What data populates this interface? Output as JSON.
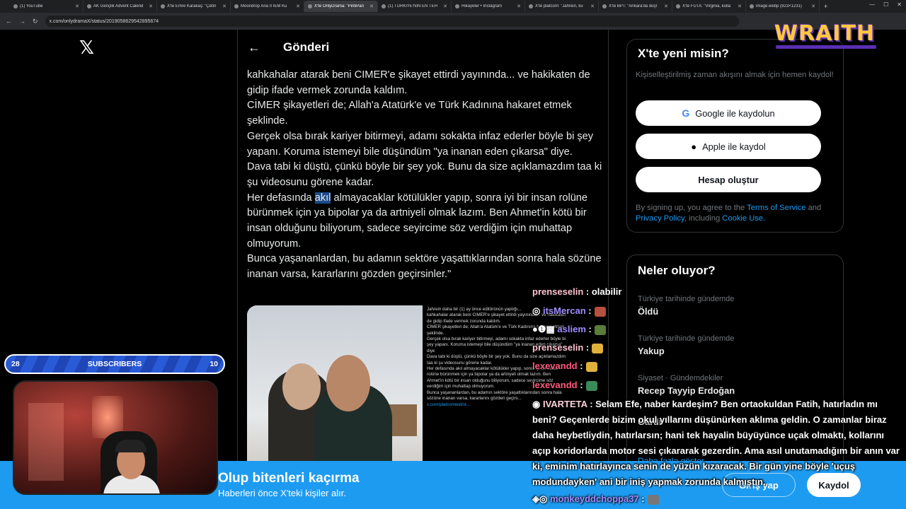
{
  "browser": {
    "tabs": [
      {
        "label": "(1) YouTube",
        "active": false
      },
      {
        "label": "AK Gençlik Advent Calend",
        "active": false
      },
      {
        "label": "X'te Emre Karakaş: \"Çetin",
        "active": false
      },
      {
        "label": "Moondrop Aria II IEM Ku",
        "active": false
      },
      {
        "label": "X'te OnlyDrama: \"PintiPan",
        "active": true
      },
      {
        "label": "(1) TÜRKİYE'NİN EN TEH",
        "active": false
      },
      {
        "label": "Hikayeler • Instagram",
        "active": false
      },
      {
        "label": "X'te platcom: \"Jahrein, ku",
        "active": false
      },
      {
        "label": "X'te BPT: \"Ankara'da düşt",
        "active": false
      },
      {
        "label": "X'te FUTA: \"Virginia, kulla",
        "active": false
      },
      {
        "label": "image.webp (923×1231)",
        "active": false
      }
    ],
    "url": "x.com/onlydramaX/status/2019058629542895674"
  },
  "post": {
    "header_title": "Gönderi",
    "lines": [
      "kahkahalar atarak beni CIMER'e şikayet ettirdi yayınında... ve hakikaten de gidip ifade vermek zorunda kaldım.",
      "CİMER şikayetleri de; Allah'a Atatürk'e ve Türk Kadınına hakaret etmek şeklinde.",
      "Gerçek olsa bırak kariyer bitirmeyi, adamı sokakta infaz ederler böyle bi şey yapanı. Koruma istemeyi bile düşündüm \"ya inanan eden çıkarsa\" diye.",
      "Dava tabi ki düştü, çünkü böyle bir şey yok. Bunu da size açıklamazdım taa ki şu videosunu görene kadar."
    ],
    "line5_before": "Her defasında ",
    "line5_highlight": "akıl",
    "line5_after": " almayacaklar kötülükler yapıp, sonra iyi bir insan rolüne bürünmek için ya bipolar ya da artniyeli olmak lazım. Ben Ahmet'in kötü bir insan olduğunu biliyorum, sadece seyircime söz verdiğim için muhattap olmuyorum.",
    "line6": "Bunca yaşananlardan, bu adamın sektöre yaşattıklarından sonra hala sözüne inanan varsa, kararlarını gözden geçirsinler.\"",
    "media_text": [
      "Jahrein daha bir (1) ay önce editörünün yaptığı...",
      "kahkahalar atarak beni CIMER'e şikayet ettirdi yayınında... ve hakikaten",
      "de gidip ifade vermek zorunda kaldım.",
      "CİMER şikayetleri de; Allah'a Atatürk'e ve Türk Kadınına hakaret etmek",
      "şeklinde.",
      "Gerçek olsa bırak kariyer bitirmeyi, adamı sokakta infaz ederler böyle bi",
      "şey yapanı. Koruma istemeyi bile düşündüm \"ya inanan eden çıkarsa\"",
      "diye",
      "Dava tabi ki düştü, çünkü böyle bir şey yok. Bunu da size açıklamazdım",
      "taa ki şu videosunu görene kadar.",
      "Her defasında akıl almayacaklar kötülükler yapıp, sonra iyi bir insan",
      "rolüne bürünmek için ya bipolar ya da artniyeli olmak lazım. Ben",
      "Ahmet'in kötü bir insan olduğunu biliyorum, sadece seyircime söz",
      "verdiğim için muhattap olmuyorum.",
      "Bunca yaşananlardan, bu adamın sektöre yaşattıklarından sonra hala",
      "sözüne inanan varsa, kararlarını gözden geçirs..."
    ],
    "media_link": "x.com/platcomwel/st..."
  },
  "signup_card": {
    "title": "X'te yeni misin?",
    "subtitle": "Kişiselleştirilmiş zaman akışını almak için hemen kaydol!",
    "google_label": "Google ile kaydolun",
    "apple_label": "Apple ile kaydol",
    "create_label": "Hesap oluştur",
    "legal_prefix": "By signing up, you agree to the ",
    "terms": "Terms of Service",
    "and": " and ",
    "privacy": "Privacy Policy",
    "including": ", including ",
    "cookie": "Cookie Use."
  },
  "trends": {
    "title": "Neler oluyor?",
    "items": [
      {
        "context": "Türkiye tarihinde gündemde",
        "name": "Öldü"
      },
      {
        "context": "Türkiye tarihinde gündemde",
        "name": "Yakup"
      },
      {
        "context": "Siyaset · Gündemdekiler",
        "name": "Recep Tayyip Erdoğan"
      },
      {
        "context": "",
        "name": "Gardi"
      }
    ],
    "more": "Daha fazla göster"
  },
  "banner": {
    "title": "Olup bitenleri kaçırma",
    "subtitle": "Haberleri önce X'teki kişiler alır.",
    "login": "Giriş yap",
    "signup": "Kaydol"
  },
  "overlay": {
    "brand": "WRAITH",
    "subs_left": "28",
    "subs_label": "SUBSCRIBERS",
    "subs_right": "10"
  },
  "chat": [
    {
      "user": "prenseselin",
      "text": ": olabilir"
    },
    {
      "user": "itsMercan",
      "text": ":"
    },
    {
      "user": "asliem",
      "text": ":"
    },
    {
      "user": "prenseselin",
      "text": ":"
    },
    {
      "user": "lexevandd",
      "text": ":"
    },
    {
      "user": "lexevandd",
      "text": ":"
    }
  ],
  "chat_main": {
    "user": "IVARTETA",
    "text": ": Selam Efe, naber kardeşim? Ben ortaokuldan Fatih, hatırladın mı beni? Geçenlerde bizim okul yıllarını düşünürken aklıma geldin. O zamanlar biraz daha heybetliydin, hatırlarsın; hani tek hayalin büyüyünce uçak olmaktı, kollarını açıp koridorlarda motor sesi çıkararak gezerdin. Ama asıl unutamadığım bir anın var ki, eminim hatırlayınca senin de yüzün kızaracak. Bir gün yine böyle 'uçuş modundayken' ani bir iniş yapmak zorunda kalmıştın."
  },
  "chat_last": {
    "user": "monkeyddchoppa37",
    "text": ":"
  }
}
